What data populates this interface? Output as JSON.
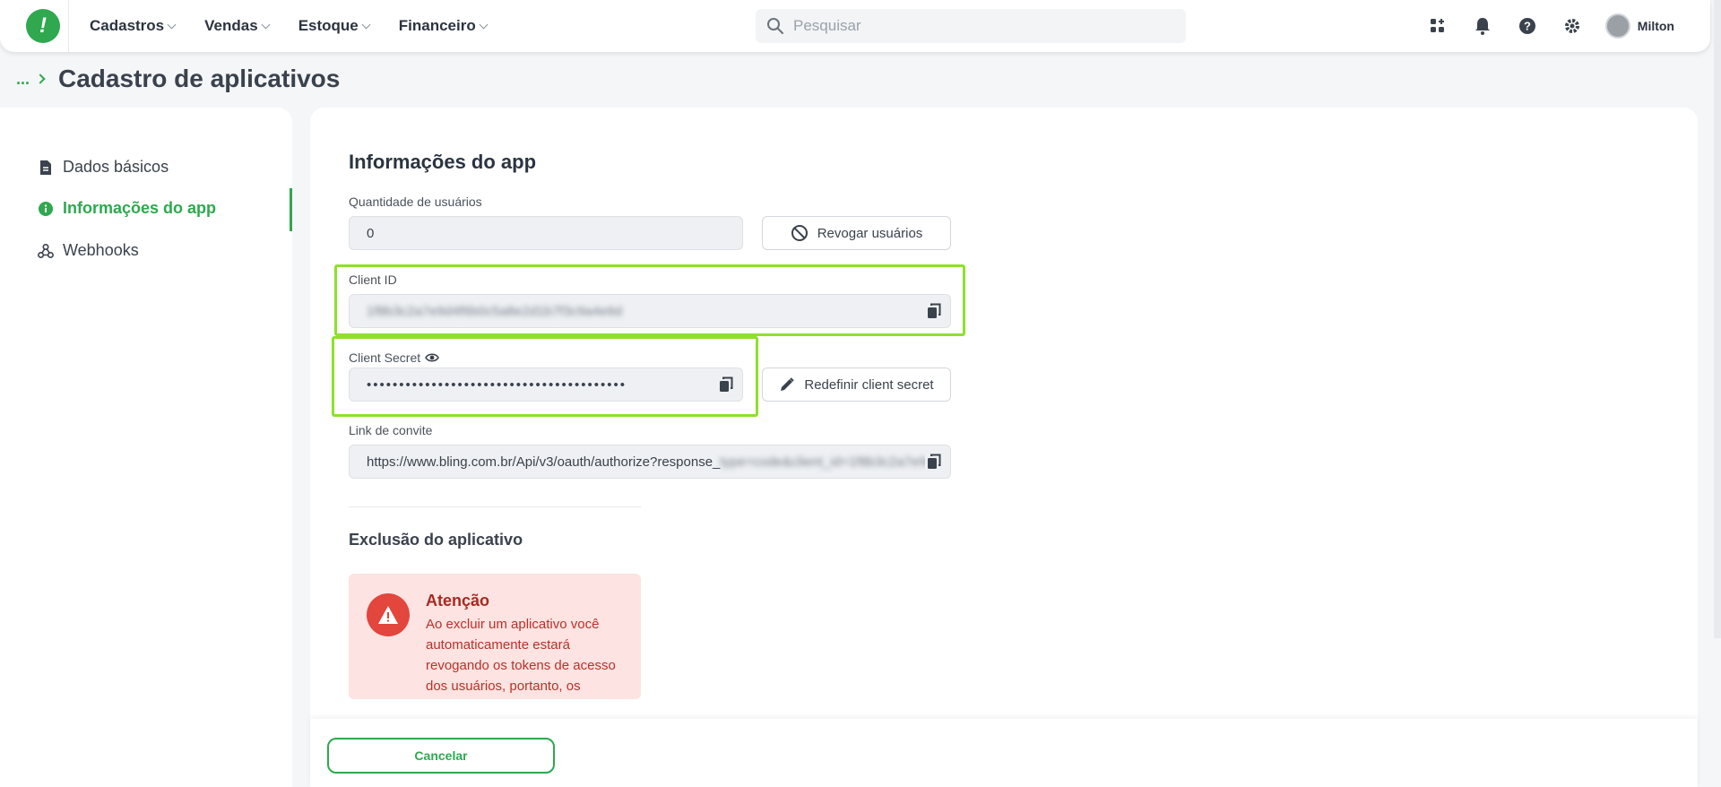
{
  "header": {
    "logo_text": "!",
    "nav": [
      {
        "label": "Cadastros"
      },
      {
        "label": "Vendas"
      },
      {
        "label": "Estoque"
      },
      {
        "label": "Financeiro"
      }
    ],
    "search_placeholder": "Pesquisar",
    "user_name": "Milton"
  },
  "breadcrumb": {
    "ellipsis": "...",
    "title": "Cadastro de aplicativos"
  },
  "sidebar": {
    "items": [
      {
        "label": "Dados básicos",
        "icon": "file-icon"
      },
      {
        "label": "Informações do app",
        "icon": "info-icon",
        "active": true
      },
      {
        "label": "Webhooks",
        "icon": "webhook-icon"
      }
    ]
  },
  "main": {
    "section_title": "Informações do app",
    "users_label": "Quantidade de usuários",
    "users_value": "0",
    "revoke_button": "Revogar usuários",
    "client_id_label": "Client ID",
    "client_id_value": "1f8b3c2a7e9d4f6b0c5a8e2d1b7f3c9a4e6d",
    "client_secret_label": "Client Secret",
    "client_secret_value": "••••••••••••••••••••••••••••••••••••••••",
    "reset_secret_button": "Redefinir client secret",
    "invite_label": "Link de convite",
    "invite_value_visible": "https://www.bling.com.br/Api/v3/oauth/authorize?response_",
    "invite_value_blurred": "type=code&client_id=1f8b3c2a7e9d",
    "delete_section_title": "Exclusão do aplicativo",
    "alert_title": "Atenção",
    "alert_text": "Ao excluir um aplicativo você automaticamente estará revogando os tokens de acesso dos usuários, portanto, os mesmos não"
  },
  "footer": {
    "cancel_button": "Cancelar"
  },
  "colors": {
    "brand_green": "#2fa84f",
    "highlight": "#8ee02b",
    "alert_bg": "#fde3e1",
    "alert_icon": "#e2463c"
  }
}
